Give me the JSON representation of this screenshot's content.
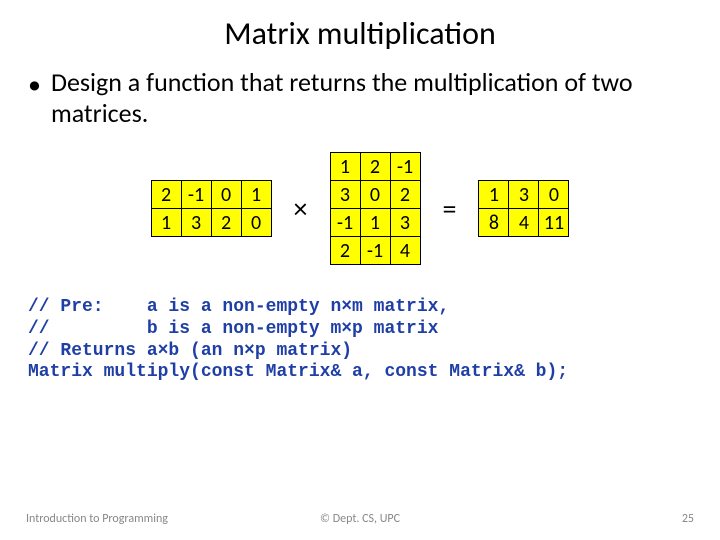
{
  "title": "Matrix multiplication",
  "bullet": "Design a function that returns the multiplication of two matrices.",
  "op_times": "×",
  "op_eq": "=",
  "matrixA": [
    [
      "2",
      "-1",
      "0",
      "1"
    ],
    [
      "1",
      "3",
      "2",
      "0"
    ]
  ],
  "matrixB": [
    [
      "1",
      "2",
      "-1"
    ],
    [
      "3",
      "0",
      "2"
    ],
    [
      "-1",
      "1",
      "3"
    ],
    [
      "2",
      "-1",
      "4"
    ]
  ],
  "matrixC": [
    [
      "1",
      "3",
      "0"
    ],
    [
      "8",
      "4",
      "11"
    ]
  ],
  "code_line1": "// Pre:    a is a non-empty n×m matrix,",
  "code_line2": "//         b is a non-empty m×p matrix",
  "code_line3": "// Returns a×b (an n×p matrix)",
  "code_line4": "Matrix multiply(const Matrix& a, const Matrix& b);",
  "footer_left": "Introduction to Programming",
  "footer_center": "© Dept. CS, UPC",
  "footer_right": "25"
}
